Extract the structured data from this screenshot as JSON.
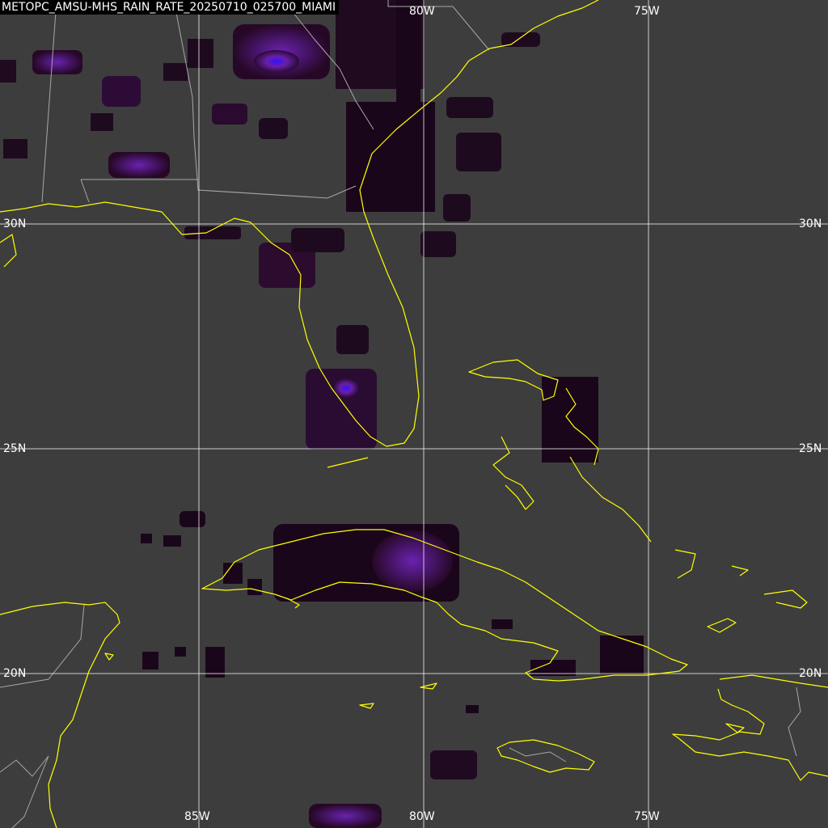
{
  "title": "METOPC_AMSU-MHS_RAIN_RATE_20250710_025700_MIAMI",
  "graticule": {
    "lon_labels_top": [
      "80W",
      "75W"
    ],
    "lon_labels_bottom": [
      "85W",
      "80W",
      "75W"
    ],
    "lat_labels_left": [
      "30N",
      "25N",
      "20N"
    ],
    "lat_labels_right": [
      "30N",
      "25N",
      "20N"
    ]
  },
  "colors": {
    "background": "#3d3d3d",
    "coastline": "#ffff00",
    "borders": "#a8a8a8",
    "grid": "#ffffff",
    "rain_low": "#220022",
    "rain_mid": "#5a1a8a",
    "rain_high": "#3311ff"
  }
}
